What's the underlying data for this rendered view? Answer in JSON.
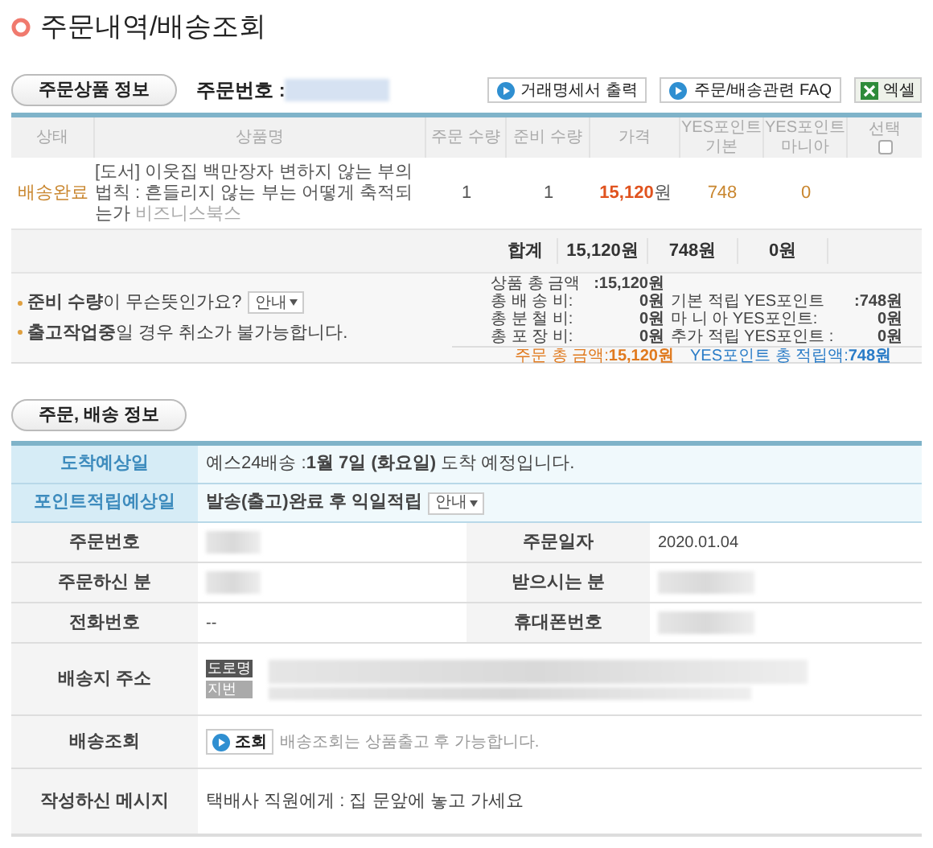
{
  "page_title": "주문내역/배송조회",
  "order_section": {
    "tab": "주문상품 정보",
    "order_number_label": "주문번호 :",
    "order_number_redacted": true,
    "buttons": [
      {
        "label": "거래명세서 출력",
        "kind": "play"
      },
      {
        "label": "주문/배송관련 FAQ",
        "kind": "play"
      },
      {
        "label": "엑셀",
        "kind": "excel"
      }
    ]
  },
  "items_table": {
    "columns": [
      "상태",
      "상품명",
      "주문 수량",
      "준비 수량",
      "가격",
      "YES포인트 기본",
      "YES포인트 마니아",
      "선택"
    ],
    "select_all": {
      "checked": false
    },
    "rows": [
      {
        "status": "배송완료",
        "title": "[도서] 이웃집 백만장자 변하지 않는 부의 법칙 : 흔들리지 않는 부는 어떻게 축적되는가",
        "publisher": "비즈니스북스",
        "order_qty": "1",
        "ready_qty": "1",
        "price": "15,120",
        "price_unit": "원",
        "points_basic": "748",
        "points_mania": "0"
      }
    ],
    "totals": {
      "label": "합계",
      "price": "15,120원",
      "points_basic": "748원",
      "points_mania": "0원"
    }
  },
  "notes": [
    {
      "text": "**준비 수량**이 무슨뜻인가요?",
      "guide": "안내"
    },
    {
      "text": "**출고작업중**일 경우 취소가 불가능합니다."
    }
  ],
  "summary": {
    "left": [
      {
        "label": "상품 총 금액",
        "value": ":15,120원"
      },
      {
        "label": "총 배 송 비:",
        "value": "0원"
      },
      {
        "label": "총 분 철 비:",
        "value": "0원"
      },
      {
        "label": "총 포 장 비:",
        "value": "0원"
      }
    ],
    "right": [
      {
        "label": "기본 적립 YES포인트",
        "value": ":748원"
      },
      {
        "label": "마 니 아 YES포인트:",
        "value": "0원"
      },
      {
        "label": "추가 적립 YES포인트 :",
        "value": "0원"
      }
    ],
    "order_total": {
      "label": "주문 총 금액:",
      "value": "15,120원"
    },
    "points_total": {
      "label": "YES포인트 총 적립액:",
      "value": "748원"
    }
  },
  "info_section": {
    "tab": "주문, 배송 정보",
    "rows": [
      {
        "kind": "highlight",
        "label": "도착예상일",
        "value": "예스24배송 :**1월 7일 (화요일)** 도착 예정입니다."
      },
      {
        "kind": "highlight",
        "label": "포인트적립예상일",
        "value": "**발송(출고)완료 후 익일적립**",
        "guide": "안내"
      },
      {
        "kind": "pair",
        "cells": [
          {
            "label": "주문번호",
            "redacted": true
          },
          {
            "label": "주문일자",
            "value": "2020.01.04"
          }
        ]
      },
      {
        "kind": "pair",
        "cells": [
          {
            "label": "주문하신 분",
            "redacted": true
          },
          {
            "label": "받으시는 분",
            "redacted": true
          }
        ]
      },
      {
        "kind": "pair",
        "cells": [
          {
            "label": "전화번호",
            "value": "--"
          },
          {
            "label": "휴대폰번호",
            "redacted": true
          }
        ]
      },
      {
        "kind": "address",
        "label": "배송지 주소",
        "tags": [
          "도로명",
          "지번"
        ]
      },
      {
        "kind": "tracking",
        "label": "배송조회",
        "button": "조회",
        "note": "배송조회는 상품출고 후 가능합니다."
      },
      {
        "kind": "text",
        "label": "작성하신 메시지",
        "value": "택배사 직원에게 : 집 문앞에 놓고 가세요"
      }
    ]
  }
}
